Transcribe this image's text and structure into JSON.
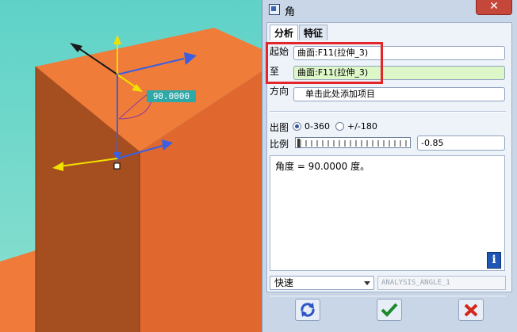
{
  "viewport": {
    "angle_readout": "90.0000"
  },
  "dialog": {
    "title": "角",
    "close_glyph": "✕",
    "tabs": [
      {
        "label": "分析",
        "active": true
      },
      {
        "label": "特征",
        "active": false
      }
    ],
    "from": {
      "label": "起始",
      "value": "曲面:F11(拉伸_3)"
    },
    "to": {
      "label": "至",
      "value": "曲面:F11(拉伸_3)"
    },
    "direction": {
      "label": "方向",
      "value": "单击此处添加项目"
    },
    "output": {
      "label": "出图",
      "options": [
        {
          "label": "0-360",
          "selected": true
        },
        {
          "label": "+/-180",
          "selected": false
        }
      ]
    },
    "scale": {
      "label": "比例",
      "value": "-0.85"
    },
    "result_text": "角度 = 90.0000 度。",
    "mode": {
      "selected": "快速"
    },
    "analysis_name": "ANALYSIS_ANGLE_1",
    "icons": {
      "info": "info-icon",
      "repeat": "repeat-icon",
      "ok": "checkmark-icon",
      "cancel": "cancel-icon"
    },
    "colors": {
      "highlight": "#e4262b",
      "selected_field": "#ddf7c9",
      "model_face": "#ef7a3a",
      "background": "#67d6c9"
    }
  }
}
